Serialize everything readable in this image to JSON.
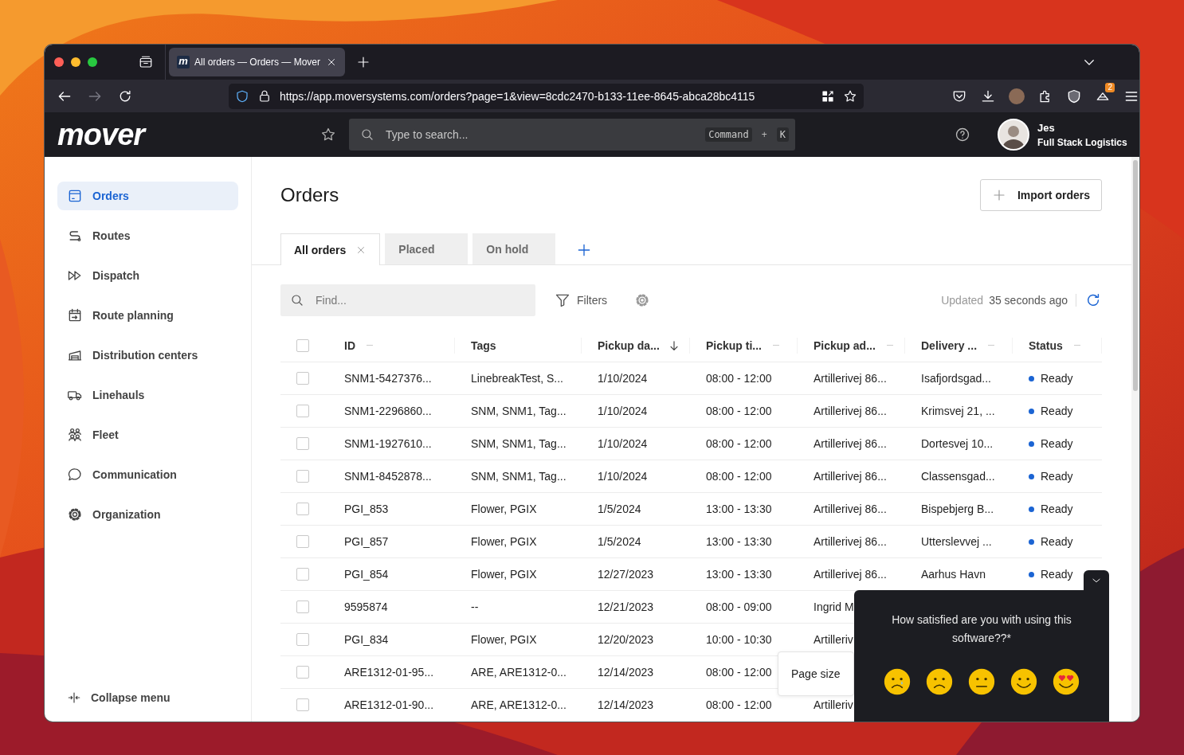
{
  "browser": {
    "tab": {
      "favicon": "m",
      "title": "All orders — Orders — Mover"
    },
    "nav": [
      {
        "kind": "back",
        "disabled": false
      },
      {
        "kind": "forward",
        "disabled": true
      },
      {
        "kind": "reload",
        "disabled": false
      }
    ],
    "url": "https://app.moversystems.com/orders?page=1&view=8cdc2470-b133-11ee-8645-abca28bc4115",
    "extension_badge": "2"
  },
  "app_header": {
    "logo": "mover",
    "search": {
      "placeholder": "Type to search...",
      "keys": [
        "Command",
        "K"
      ],
      "joiner": "+"
    },
    "user": {
      "name": "Jes",
      "org": "Full Stack Logistics"
    }
  },
  "sidebar": {
    "items": [
      {
        "kind": "orders",
        "label": "Orders",
        "selected": true
      },
      {
        "kind": "routes",
        "label": "Routes",
        "selected": false
      },
      {
        "kind": "dispatch",
        "label": "Dispatch",
        "selected": false
      },
      {
        "kind": "planning",
        "label": "Route planning",
        "selected": false
      },
      {
        "kind": "distribution",
        "label": "Distribution centers",
        "selected": false
      },
      {
        "kind": "linehauls",
        "label": "Linehauls",
        "selected": false
      },
      {
        "kind": "fleet",
        "label": "Fleet",
        "selected": false
      },
      {
        "kind": "communication",
        "label": "Communication",
        "selected": false
      },
      {
        "kind": "organization",
        "label": "Organization",
        "selected": false
      }
    ],
    "collapse": "Collapse menu"
  },
  "main": {
    "title": "Orders",
    "import_button": "Import orders",
    "tabs": [
      {
        "label": "All orders",
        "selected": true
      },
      {
        "label": "Placed",
        "selected": false
      },
      {
        "label": "On hold",
        "selected": false
      }
    ],
    "find_placeholder": "Find...",
    "filters": "Filters",
    "updated_label": "Updated",
    "updated_value": "35 seconds ago"
  },
  "table": {
    "select_all": {
      "checked": false
    },
    "columns": [
      {
        "label": "ID",
        "sorted": false
      },
      {
        "label": "Tags"
      },
      {
        "label": "Pickup da...",
        "sorted": true
      },
      {
        "label": "Pickup ti...",
        "sorted": false
      },
      {
        "label": "Pickup ad...",
        "sorted": false
      },
      {
        "label": "Delivery ...",
        "sorted": false
      },
      {
        "label": "Status",
        "sorted": false
      }
    ],
    "rows": [
      {
        "checked": false,
        "cells": [
          "SNM1-5427376...",
          "LinebreakTest, S...",
          "1/10/2024",
          "08:00 - 12:00",
          "Artillerivej 86...",
          "Isafjordsgad...",
          "Ready"
        ]
      },
      {
        "checked": false,
        "cells": [
          "SNM1-2296860...",
          "SNM, SNM1, Tag...",
          "1/10/2024",
          "08:00 - 12:00",
          "Artillerivej 86...",
          "Krimsvej 21, ...",
          "Ready"
        ]
      },
      {
        "checked": false,
        "cells": [
          "SNM1-1927610...",
          "SNM, SNM1, Tag...",
          "1/10/2024",
          "08:00 - 12:00",
          "Artillerivej 86...",
          "Dortesvej 10...",
          "Ready"
        ]
      },
      {
        "checked": false,
        "cells": [
          "SNM1-8452878...",
          "SNM, SNM1, Tag...",
          "1/10/2024",
          "08:00 - 12:00",
          "Artillerivej 86...",
          "Classensgad...",
          "Ready"
        ]
      },
      {
        "checked": false,
        "cells": [
          "PGI_853",
          "Flower, PGIX",
          "1/5/2024",
          "13:00 - 13:30",
          "Artillerivej 86...",
          "Bispebjerg B...",
          "Ready"
        ]
      },
      {
        "checked": false,
        "cells": [
          "PGI_857",
          "Flower, PGIX",
          "1/5/2024",
          "13:00 - 13:30",
          "Artillerivej 86...",
          "Utterslevvej ...",
          "Ready"
        ]
      },
      {
        "checked": false,
        "cells": [
          "PGI_854",
          "Flower, PGIX",
          "12/27/2023",
          "13:00 - 13:30",
          "Artillerivej 86...",
          "Aarhus Havn",
          "Ready"
        ]
      },
      {
        "checked": false,
        "cells": [
          "9595874",
          "--",
          "12/21/2023",
          "08:00 - 09:00",
          "Ingrid M"
        ]
      },
      {
        "checked": false,
        "cells": [
          "PGI_834",
          "Flower, PGIX",
          "12/20/2023",
          "10:00 - 10:30",
          "Artilleriv"
        ]
      },
      {
        "checked": false,
        "cells": [
          "ARE1312-01-95...",
          "ARE, ARE1312-0...",
          "12/14/2023",
          "08:00 - 12:00"
        ]
      },
      {
        "checked": false,
        "cells": [
          "ARE1312-01-90...",
          "ARE, ARE1312-0...",
          "12/14/2023",
          "08:00 - 12:00",
          "Artilleriv"
        ]
      }
    ]
  },
  "page_size": {
    "label": "Page size"
  },
  "survey": {
    "question": "How satisfied are you with using this software??*",
    "faces": [
      {
        "kind": "crying"
      },
      {
        "kind": "sad"
      },
      {
        "kind": "neutral"
      },
      {
        "kind": "smile"
      },
      {
        "kind": "heart-eyes"
      }
    ]
  }
}
